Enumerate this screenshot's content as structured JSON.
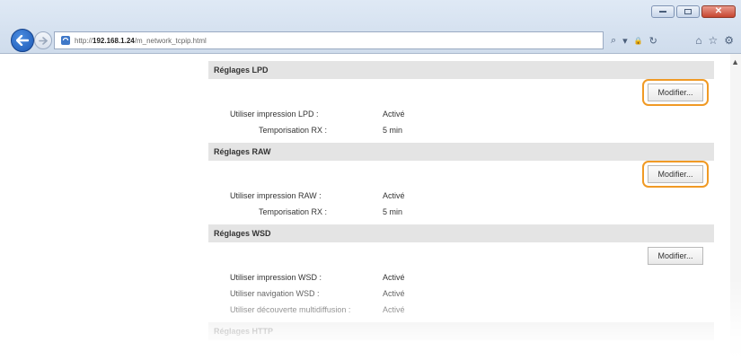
{
  "browser": {
    "url_prefix": "http://",
    "url_host": "192.168.1.24",
    "url_path": "/m_network_tcpip.html",
    "tools": {
      "search": "⌕",
      "dropdown": "▾",
      "cert": "🔒",
      "refresh": "↻",
      "home": "⌂",
      "favorites": "☆",
      "settings": "⚙"
    }
  },
  "sections": [
    {
      "title": "Réglages LPD",
      "button": "Modifier...",
      "highlighted": true,
      "rows": [
        {
          "label": "Utiliser impression LPD :",
          "value": "Activé"
        },
        {
          "label": "Temporisation RX :",
          "value": "5 min"
        }
      ]
    },
    {
      "title": "Réglages RAW",
      "button": "Modifier...",
      "highlighted": true,
      "rows": [
        {
          "label": "Utiliser impression RAW :",
          "value": "Activé"
        },
        {
          "label": "Temporisation RX :",
          "value": "5 min"
        }
      ]
    },
    {
      "title": "Réglages WSD",
      "button": "Modifier...",
      "highlighted": false,
      "rows": [
        {
          "label": "Utiliser impression WSD :",
          "value": "Activé"
        },
        {
          "label": "Utiliser navigation WSD :",
          "value": "Activé"
        },
        {
          "label": "Utiliser découverte multidiffusion :",
          "value": "Activé"
        }
      ]
    },
    {
      "title": "Réglages HTTP"
    }
  ],
  "colors": {
    "highlight": "#f09a25",
    "section_header_bg": "#e4e4e4",
    "back_button": "#2a6ad0"
  }
}
